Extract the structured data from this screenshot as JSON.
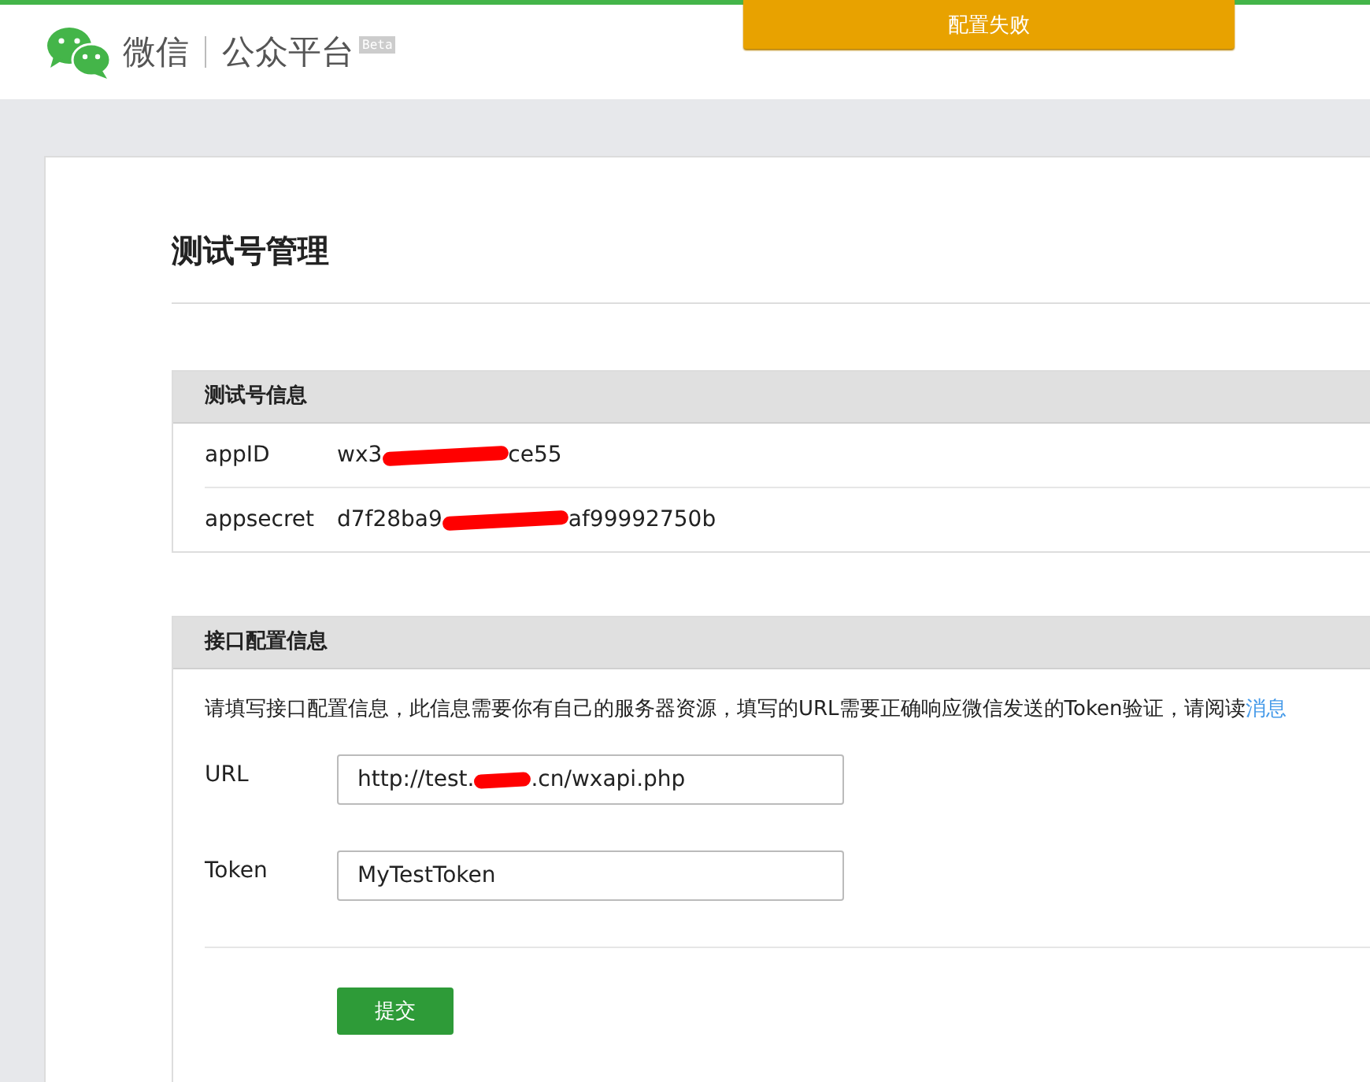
{
  "header": {
    "brand": "微信",
    "product": "公众平台",
    "badge": "Beta"
  },
  "toast": {
    "text": "配置失败"
  },
  "page_title": "测试号管理",
  "test_account": {
    "title": "测试号信息",
    "rows": [
      {
        "label": "appID",
        "value_start": "wx3",
        "value_end": "ce55"
      },
      {
        "label": "appsecret",
        "value_start": "d7f28ba9",
        "value_end": "af99992750b"
      }
    ]
  },
  "interface_config": {
    "title": "接口配置信息",
    "description": "请填写接口配置信息，此信息需要你有自己的服务器资源，填写的URL需要正确响应微信发送的Token验证，请阅读",
    "link": "消息",
    "fields": [
      {
        "label": "URL",
        "value_start": "http://test.",
        "value_end": ".cn/wxapi.php"
      },
      {
        "label": "Token",
        "value_start": "MyTestToken"
      }
    ],
    "submit": "提交"
  }
}
